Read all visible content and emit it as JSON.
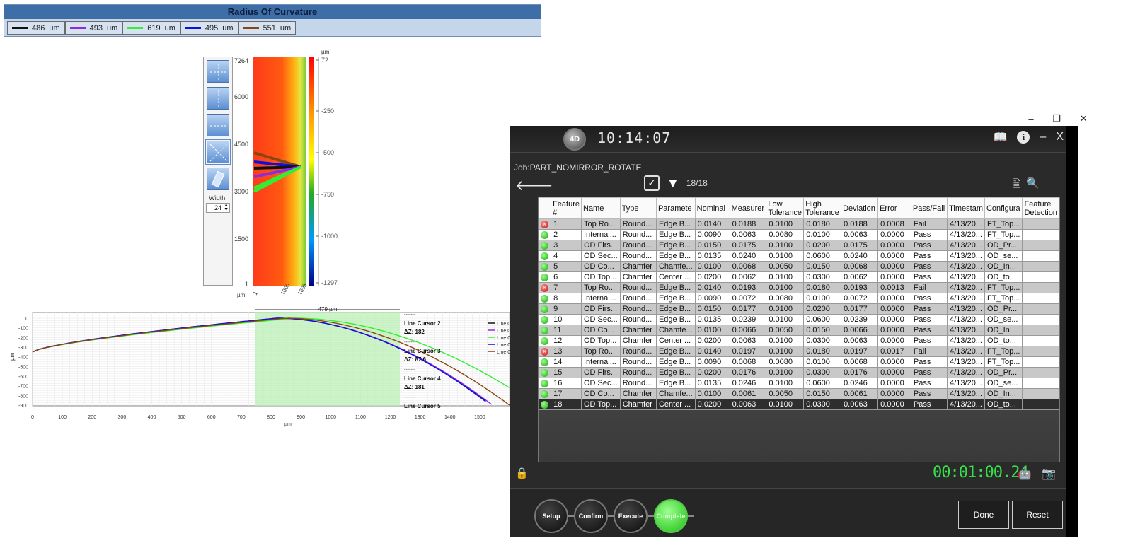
{
  "radius_panel": {
    "title": "Radius Of Curvature",
    "items": [
      {
        "value": "486",
        "unit": "um",
        "color": "#111111"
      },
      {
        "value": "493",
        "unit": "um",
        "color": "#8b2be2"
      },
      {
        "value": "619",
        "unit": "um",
        "color": "#33ee33"
      },
      {
        "value": "495",
        "unit": "um",
        "color": "#1010dd"
      },
      {
        "value": "551",
        "unit": "um",
        "color": "#8b4513"
      }
    ]
  },
  "tools": {
    "width_label": "Width:",
    "width_value": "24"
  },
  "heatmap": {
    "y_ticks": [
      "7264",
      "6000",
      "4500",
      "3000",
      "1500",
      "1"
    ],
    "x_ticks": [
      "1",
      "1000",
      "1693"
    ],
    "x_unit": "µm",
    "scale_unit": "µm",
    "scale_ticks": [
      "72",
      "-250",
      "-500",
      "-750",
      "-1000",
      "-1297"
    ]
  },
  "profile": {
    "y_ticks": [
      "0",
      "-100",
      "-200",
      "-300",
      "-400",
      "-500",
      "-600",
      "-700",
      "-800",
      "-900"
    ],
    "y_unit": "µm",
    "x_ticks": [
      "0",
      "100",
      "200",
      "300",
      "400",
      "500",
      "600",
      "700",
      "800",
      "900",
      "1000",
      "1100",
      "1200",
      "1300",
      "1400",
      "1500"
    ],
    "x_unit": "µm",
    "span_label": "479 µm",
    "annotations": [
      {
        "sep": "-------",
        "label": "Line Cursor 2",
        "dz": "ΔZ: 182"
      },
      {
        "sep": "-------",
        "label": "Line Cursor 3",
        "dz": "ΔZ: 87.6"
      },
      {
        "sep": "-------",
        "label": "Line Cursor 4",
        "dz": "ΔZ: 181"
      },
      {
        "sep": "-------",
        "label": "Line Cursor 5",
        "dz": ""
      }
    ],
    "legend": [
      {
        "label": "Line C",
        "color": "#111111"
      },
      {
        "label": "Line C",
        "color": "#8b2be2"
      },
      {
        "label": "Line C",
        "color": "#33ee33"
      },
      {
        "label": "Line C",
        "color": "#1010dd"
      },
      {
        "label": "Line C",
        "color": "#8b4513"
      }
    ]
  },
  "app": {
    "logo": "4D",
    "clock": "10:14:07",
    "window_controls": [
      "–",
      "❐",
      "✕"
    ],
    "header_controls": [
      "–",
      "X"
    ],
    "job_label": "Job:PART_NOMIRROR_ROTATE",
    "filter_count": "18/18",
    "columns": [
      "",
      "Feature #",
      "Name",
      "Type",
      "Paramete",
      "Nominal",
      "Measurer",
      "Low Tolerance",
      "High Tolerance",
      "Deviation",
      "Error",
      "Pass/Fail",
      "Timestam",
      "Configura",
      "Feature Detection"
    ],
    "rows": [
      {
        "status": "fail",
        "c": [
          "1",
          "Top Ro...",
          "Round...",
          "Edge B...",
          "0.0140",
          "0.0188",
          "0.0100",
          "0.0180",
          "0.0188",
          "0.0008",
          "Fail",
          "4/13/20...",
          "FT_Top...",
          ""
        ]
      },
      {
        "status": "pass",
        "c": [
          "2",
          "Internal...",
          "Round...",
          "Edge B...",
          "0.0090",
          "0.0063",
          "0.0080",
          "0.0100",
          "0.0063",
          "0.0000",
          "Pass",
          "4/13/20...",
          "FT_Top...",
          ""
        ]
      },
      {
        "status": "pass",
        "c": [
          "3",
          "OD Firs...",
          "Round...",
          "Edge B...",
          "0.0150",
          "0.0175",
          "0.0100",
          "0.0200",
          "0.0175",
          "0.0000",
          "Pass",
          "4/13/20...",
          "OD_Pr...",
          ""
        ]
      },
      {
        "status": "pass",
        "c": [
          "4",
          "OD Sec...",
          "Round...",
          "Edge B...",
          "0.0135",
          "0.0240",
          "0.0100",
          "0.0600",
          "0.0240",
          "0.0000",
          "Pass",
          "4/13/20...",
          "OD_se...",
          ""
        ]
      },
      {
        "status": "pass",
        "c": [
          "5",
          "OD Co...",
          "Chamfer",
          "Chamfe...",
          "0.0100",
          "0.0068",
          "0.0050",
          "0.0150",
          "0.0068",
          "0.0000",
          "Pass",
          "4/13/20...",
          "OD_In...",
          ""
        ]
      },
      {
        "status": "pass",
        "c": [
          "6",
          "OD Top...",
          "Chamfer",
          "Center ...",
          "0.0200",
          "0.0062",
          "0.0100",
          "0.0300",
          "0.0062",
          "0.0000",
          "Pass",
          "4/13/20...",
          "OD_to...",
          ""
        ]
      },
      {
        "status": "fail",
        "c": [
          "7",
          "Top Ro...",
          "Round...",
          "Edge B...",
          "0.0140",
          "0.0193",
          "0.0100",
          "0.0180",
          "0.0193",
          "0.0013",
          "Fail",
          "4/13/20...",
          "FT_Top...",
          ""
        ]
      },
      {
        "status": "pass",
        "c": [
          "8",
          "Internal...",
          "Round...",
          "Edge B...",
          "0.0090",
          "0.0072",
          "0.0080",
          "0.0100",
          "0.0072",
          "0.0000",
          "Pass",
          "4/13/20...",
          "FT_Top...",
          ""
        ]
      },
      {
        "status": "pass",
        "c": [
          "9",
          "OD Firs...",
          "Round...",
          "Edge B...",
          "0.0150",
          "0.0177",
          "0.0100",
          "0.0200",
          "0.0177",
          "0.0000",
          "Pass",
          "4/13/20...",
          "OD_Pr...",
          ""
        ]
      },
      {
        "status": "pass",
        "c": [
          "10",
          "OD Sec...",
          "Round...",
          "Edge B...",
          "0.0135",
          "0.0239",
          "0.0100",
          "0.0600",
          "0.0239",
          "0.0000",
          "Pass",
          "4/13/20...",
          "OD_se...",
          ""
        ]
      },
      {
        "status": "pass",
        "c": [
          "11",
          "OD Co...",
          "Chamfer",
          "Chamfe...",
          "0.0100",
          "0.0066",
          "0.0050",
          "0.0150",
          "0.0066",
          "0.0000",
          "Pass",
          "4/13/20...",
          "OD_In...",
          ""
        ]
      },
      {
        "status": "pass",
        "c": [
          "12",
          "OD Top...",
          "Chamfer",
          "Center ...",
          "0.0200",
          "0.0063",
          "0.0100",
          "0.0300",
          "0.0063",
          "0.0000",
          "Pass",
          "4/13/20...",
          "OD_to...",
          ""
        ]
      },
      {
        "status": "fail",
        "c": [
          "13",
          "Top Ro...",
          "Round...",
          "Edge B...",
          "0.0140",
          "0.0197",
          "0.0100",
          "0.0180",
          "0.0197",
          "0.0017",
          "Fail",
          "4/13/20...",
          "FT_Top...",
          ""
        ]
      },
      {
        "status": "pass",
        "c": [
          "14",
          "Internal...",
          "Round...",
          "Edge B...",
          "0.0090",
          "0.0068",
          "0.0080",
          "0.0100",
          "0.0068",
          "0.0000",
          "Pass",
          "4/13/20...",
          "FT_Top...",
          ""
        ]
      },
      {
        "status": "pass",
        "c": [
          "15",
          "OD Firs...",
          "Round...",
          "Edge B...",
          "0.0200",
          "0.0176",
          "0.0100",
          "0.0300",
          "0.0176",
          "0.0000",
          "Pass",
          "4/13/20...",
          "OD_Pr...",
          ""
        ]
      },
      {
        "status": "pass",
        "c": [
          "16",
          "OD Sec...",
          "Round...",
          "Edge B...",
          "0.0135",
          "0.0246",
          "0.0100",
          "0.0600",
          "0.0246",
          "0.0000",
          "Pass",
          "4/13/20...",
          "OD_se...",
          ""
        ]
      },
      {
        "status": "pass",
        "c": [
          "17",
          "OD Co...",
          "Chamfer",
          "Chamfe...",
          "0.0100",
          "0.0061",
          "0.0050",
          "0.0150",
          "0.0061",
          "0.0000",
          "Pass",
          "4/13/20...",
          "OD_In...",
          ""
        ]
      },
      {
        "status": "pass",
        "c": [
          "18",
          "OD Top...",
          "Chamfer",
          "Center ...",
          "0.0200",
          "0.0063",
          "0.0100",
          "0.0300",
          "0.0063",
          "0.0000",
          "Pass",
          "4/13/20...",
          "OD_to...",
          ""
        ]
      }
    ],
    "selected_row": 17,
    "timer": "00:01:00.24",
    "steps": [
      "Setup",
      "Confirm",
      "Execute",
      "Complete"
    ],
    "done_label": "Done",
    "reset_label": "Reset",
    "accent_color": "#36e24a"
  }
}
